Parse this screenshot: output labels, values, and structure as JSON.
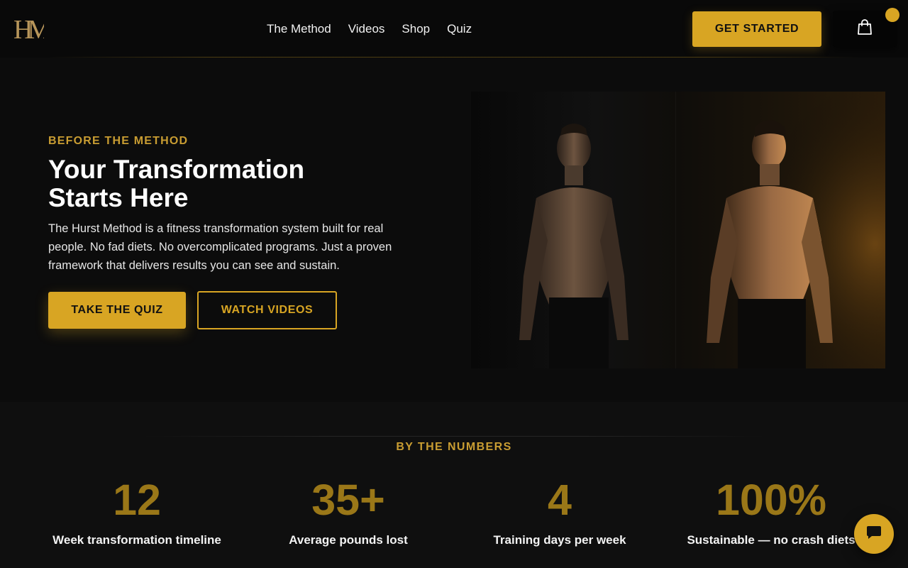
{
  "brand": {
    "logo_text": "HM",
    "accent_color": "#d8a523"
  },
  "nav": {
    "links": [
      "The Method",
      "Videos",
      "Shop",
      "Quiz"
    ],
    "cta_label": "GET STARTED",
    "cart_icon": "shopping-bag-icon"
  },
  "hero": {
    "eyebrow": "BEFORE THE METHOD",
    "title": "Your Transformation Starts Here",
    "description": "The Hurst Method is a fitness transformation system built for real people. No fad diets. No overcomplicated programs. Just a proven framework that delivers results you can see and sustain.",
    "primary_button": "TAKE THE QUIZ",
    "secondary_button": "WATCH VIDEOS",
    "image": "before-after-transformation-photo"
  },
  "stats": {
    "heading": "BY THE NUMBERS",
    "items": [
      {
        "value": "12",
        "label": "Week transformation timeline"
      },
      {
        "value": "35+",
        "label": "Average pounds lost"
      },
      {
        "value": "4",
        "label": "Training days per week"
      },
      {
        "value": "100%",
        "label": "Sustainable — no crash diets"
      }
    ]
  },
  "chat": {
    "icon": "chat-bubble-icon"
  }
}
